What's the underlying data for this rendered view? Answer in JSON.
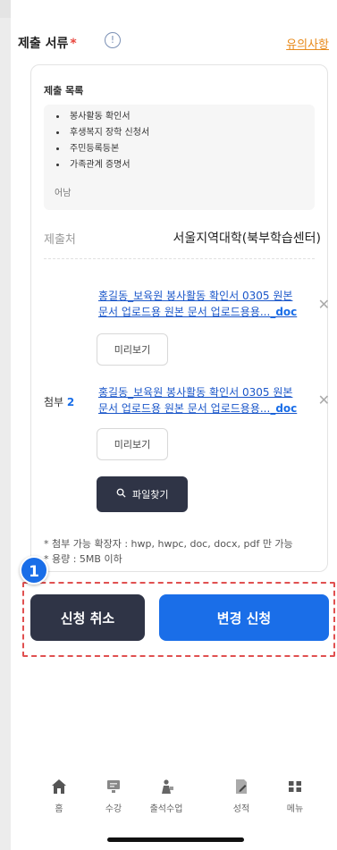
{
  "section": {
    "title": "제출 서류",
    "required_mark": "*",
    "info_icon": "!",
    "notice_link": "유의사항"
  },
  "documents": {
    "label": "제출 목록",
    "items": [
      "봉사활동 확인서",
      "후생복지 장학 신청서",
      "주민등록등본",
      "가족관계 증명서"
    ],
    "extra": "어남"
  },
  "destination": {
    "label": "제출처",
    "value": "서울지역대학(북부학습센터)"
  },
  "attachments": {
    "label": "첨부",
    "count": "2",
    "files": [
      {
        "name_line1": "홍길동_보육원 봉사활동 확인서 0305 원본",
        "name_line2": "문서 업로드용 원본 문서 업로드용용...",
        "ext": "_doc",
        "preview": "미리보기",
        "close": "✕"
      },
      {
        "name_line1": "홍길동_보육원 봉사활동 확인서 0305 원본",
        "name_line2": "문서 업로드용 원본 문서 업로드용용...",
        "ext": "_doc",
        "preview": "미리보기",
        "close": "✕"
      }
    ],
    "find_button": "파일찾기",
    "notes": [
      "* 첨부 가능 확장자 : hwp, hwpc, doc, docx, pdf 만 가능",
      "* 용량 : 5MB 이하"
    ]
  },
  "annotation": {
    "badge": "1"
  },
  "actions": {
    "cancel": "신청 취소",
    "submit": "변경 신청"
  },
  "tabbar": [
    {
      "icon": "home-icon",
      "label": "홈"
    },
    {
      "icon": "lecture-icon",
      "label": "수강"
    },
    {
      "icon": "attendance-icon",
      "label": "출석수업"
    },
    {
      "icon": "grades-icon",
      "label": "성적"
    },
    {
      "icon": "menu-grid-icon",
      "label": "메뉴"
    }
  ],
  "colors": {
    "primary": "#1a6ee8",
    "dark": "#2f3446",
    "accent_orange": "#e88a1a",
    "annotation_red": "#e05050"
  }
}
